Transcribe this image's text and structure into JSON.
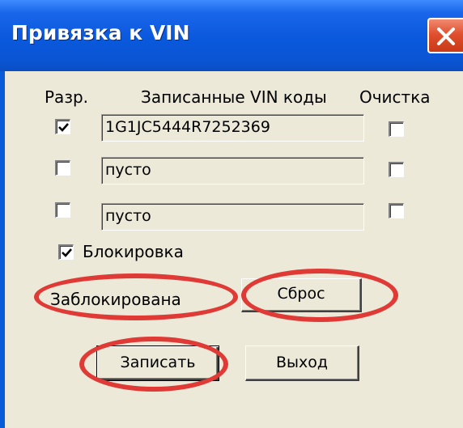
{
  "window": {
    "title": "Привязка к VIN",
    "close_label": "close"
  },
  "columns": {
    "enable": "Разр.",
    "codes": "Записанные VIN коды",
    "clear": "Очистка"
  },
  "rows": [
    {
      "enabled": true,
      "code": "1G1JC5444R7252369",
      "clear": false
    },
    {
      "enabled": false,
      "code": "пусто",
      "clear": false
    },
    {
      "enabled": false,
      "code": "пусто",
      "clear": false
    }
  ],
  "lock": {
    "label": "Блокировка",
    "checked": true,
    "status": "Заблокирована"
  },
  "buttons": {
    "reset": "Сброс",
    "write": "Записать",
    "exit": "Выход"
  },
  "colors": {
    "annotation": "#e03a36",
    "title_bar": "#0a58dc",
    "dialog_bg": "#ece9d8"
  }
}
